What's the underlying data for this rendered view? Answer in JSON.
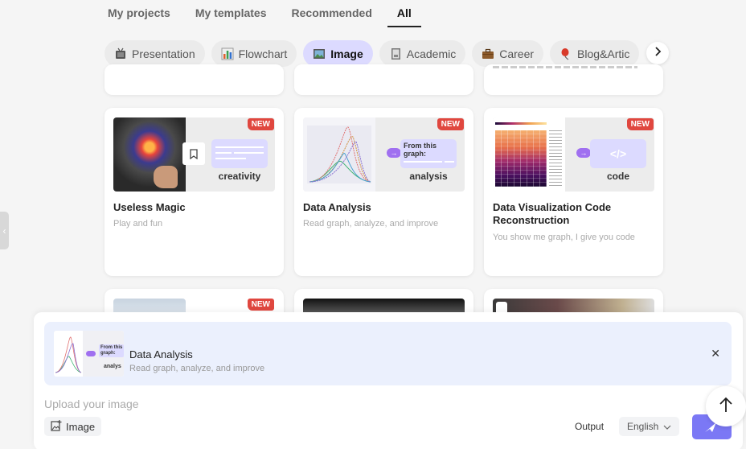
{
  "tabs": [
    {
      "label": "My projects",
      "active": false
    },
    {
      "label": "My templates",
      "active": false
    },
    {
      "label": "Recommended",
      "active": false
    },
    {
      "label": "All",
      "active": true
    }
  ],
  "categories": [
    {
      "label": "Presentation",
      "icon": "tv-icon",
      "active": false
    },
    {
      "label": "Flowchart",
      "icon": "bar-chart-icon",
      "active": false
    },
    {
      "label": "Image",
      "icon": "picture-icon",
      "active": true
    },
    {
      "label": "Academic",
      "icon": "notebook-icon",
      "active": false
    },
    {
      "label": "Career",
      "icon": "briefcase-icon",
      "active": false
    },
    {
      "label": "Blog&Artic",
      "icon": "balloon-icon",
      "active": false
    }
  ],
  "cards": [
    {
      "title": "Useless Magic",
      "description": "Play and fun",
      "badge": "NEW",
      "output_label": "creativity"
    },
    {
      "title": "Data Analysis",
      "description": "Read graph, analyze, and improve",
      "badge": "NEW",
      "bubble_text": "From this graph:",
      "output_label": "analysis"
    },
    {
      "title": "Data Visualization Code Reconstruction",
      "description": "You show me graph, I give you code",
      "badge": "NEW",
      "bubble_text": "</>",
      "output_label": "code"
    }
  ],
  "next_row_badge": "NEW",
  "composer": {
    "selected_template": {
      "title": "Data Analysis",
      "description": "Read graph, analyze, and improve",
      "thumb_bubble": "From this graph:",
      "thumb_label": "analys"
    },
    "placeholder": "Upload your image",
    "image_button": "Image",
    "output_label": "Output",
    "language": "English"
  },
  "colors": {
    "accent": "#7b78f5",
    "chip_active": "#dcdaff",
    "badge": "#e0473f",
    "selected_bg": "#ebf0fd"
  }
}
